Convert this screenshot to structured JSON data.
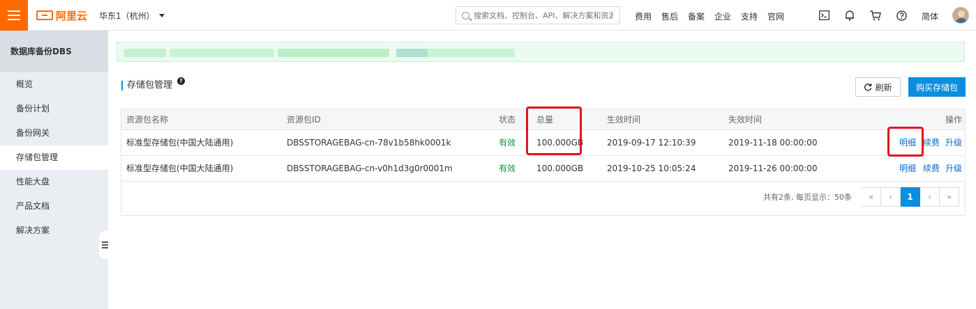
{
  "topbar": {
    "brand": "阿里云",
    "region": "华东1（杭州）",
    "search_placeholder": "搜索文档、控制台、API、解决方案和资源",
    "links": [
      "费用",
      "售后",
      "备案",
      "企业",
      "支持",
      "官网"
    ],
    "icons": [
      "terminal-icon",
      "bell-icon",
      "cart-icon",
      "help-circle-icon"
    ],
    "language": "简体"
  },
  "sidebar": {
    "title": "数据库备份DBS",
    "items": [
      {
        "label": "概览",
        "active": false
      },
      {
        "label": "备份计划",
        "active": false
      },
      {
        "label": "备份网关",
        "active": false
      },
      {
        "label": "存储包管理",
        "active": true
      },
      {
        "label": "性能大盘",
        "active": false
      },
      {
        "label": "产品文档",
        "active": false
      },
      {
        "label": "解决方案",
        "active": false
      }
    ]
  },
  "main": {
    "section_title": "存储包管理",
    "refresh_label": "刷新",
    "buy_label": "购买存储包",
    "table": {
      "headers": {
        "name": "资源包名称",
        "id": "资源包ID",
        "status": "状态",
        "total": "总量",
        "start": "生效时间",
        "end": "失效时间",
        "ops": "操作"
      },
      "rows": [
        {
          "name": "标准型存储包(中国大陆通用)",
          "id": "DBSSTORAGEBAG-cn-78v1b58hk0001k",
          "status": "有效",
          "total": "100.000GB",
          "start": "2019-09-17 12:10:39",
          "end": "2019-11-18 00:00:00",
          "op_detail": "明细",
          "op_renew": "续费",
          "op_upgrade": "升级"
        },
        {
          "name": "标准型存储包(中国大陆通用)",
          "id": "DBSSTORAGEBAG-cn-v0h1d3g0r0001m",
          "status": "有效",
          "total": "100.000GB",
          "start": "2019-10-25 10:05:24",
          "end": "2019-11-26 00:00:00",
          "op_detail": "明细",
          "op_renew": "续费",
          "op_upgrade": "升级"
        }
      ]
    },
    "pager": {
      "info": "共有2条, 每页显示：50条",
      "first": "«",
      "prev": "‹",
      "current": "1",
      "next": "›",
      "last": "»"
    }
  },
  "colors": {
    "brand": "#ff6a00",
    "primary": "#0a8ee0",
    "status_ok": "#1e8e3e",
    "highlight": "#e0141e"
  }
}
